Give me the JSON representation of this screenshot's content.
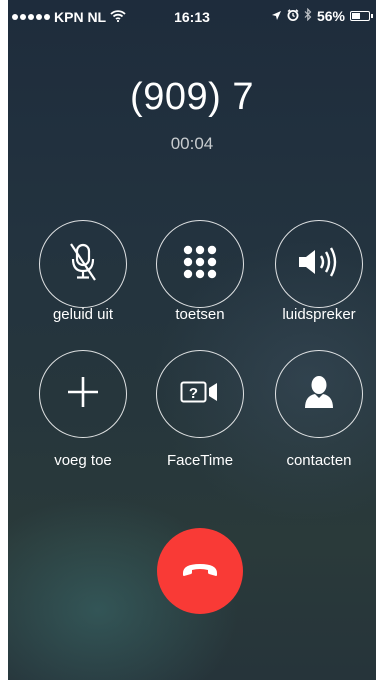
{
  "status_bar": {
    "carrier": "KPN NL",
    "time": "16:13",
    "battery": "56%",
    "battery_level": 0.56,
    "icons": [
      "signal-dots-icon",
      "wifi-icon",
      "location-arrow-icon",
      "alarm-icon",
      "bluetooth-icon",
      "battery-icon"
    ]
  },
  "call": {
    "number": "(909) 7",
    "duration": "00:04"
  },
  "buttons": {
    "mute": {
      "label": "geluid uit",
      "icon": "microphone-muted-icon"
    },
    "keypad": {
      "label": "toetsen",
      "icon": "keypad-icon"
    },
    "speaker": {
      "label": "luidspreker",
      "icon": "speaker-icon"
    },
    "add_call": {
      "label": "voeg toe",
      "icon": "plus-icon"
    },
    "facetime": {
      "label": "FaceTime",
      "icon": "facetime-unknown-icon"
    },
    "contacts": {
      "label": "contacten",
      "icon": "contact-silhouette-icon"
    },
    "end_call": {
      "icon": "end-call-phone-icon",
      "color": "#f93a36"
    }
  },
  "colors": {
    "background": "#23333f",
    "end_call": "#f93a36",
    "text": "#ffffff"
  }
}
